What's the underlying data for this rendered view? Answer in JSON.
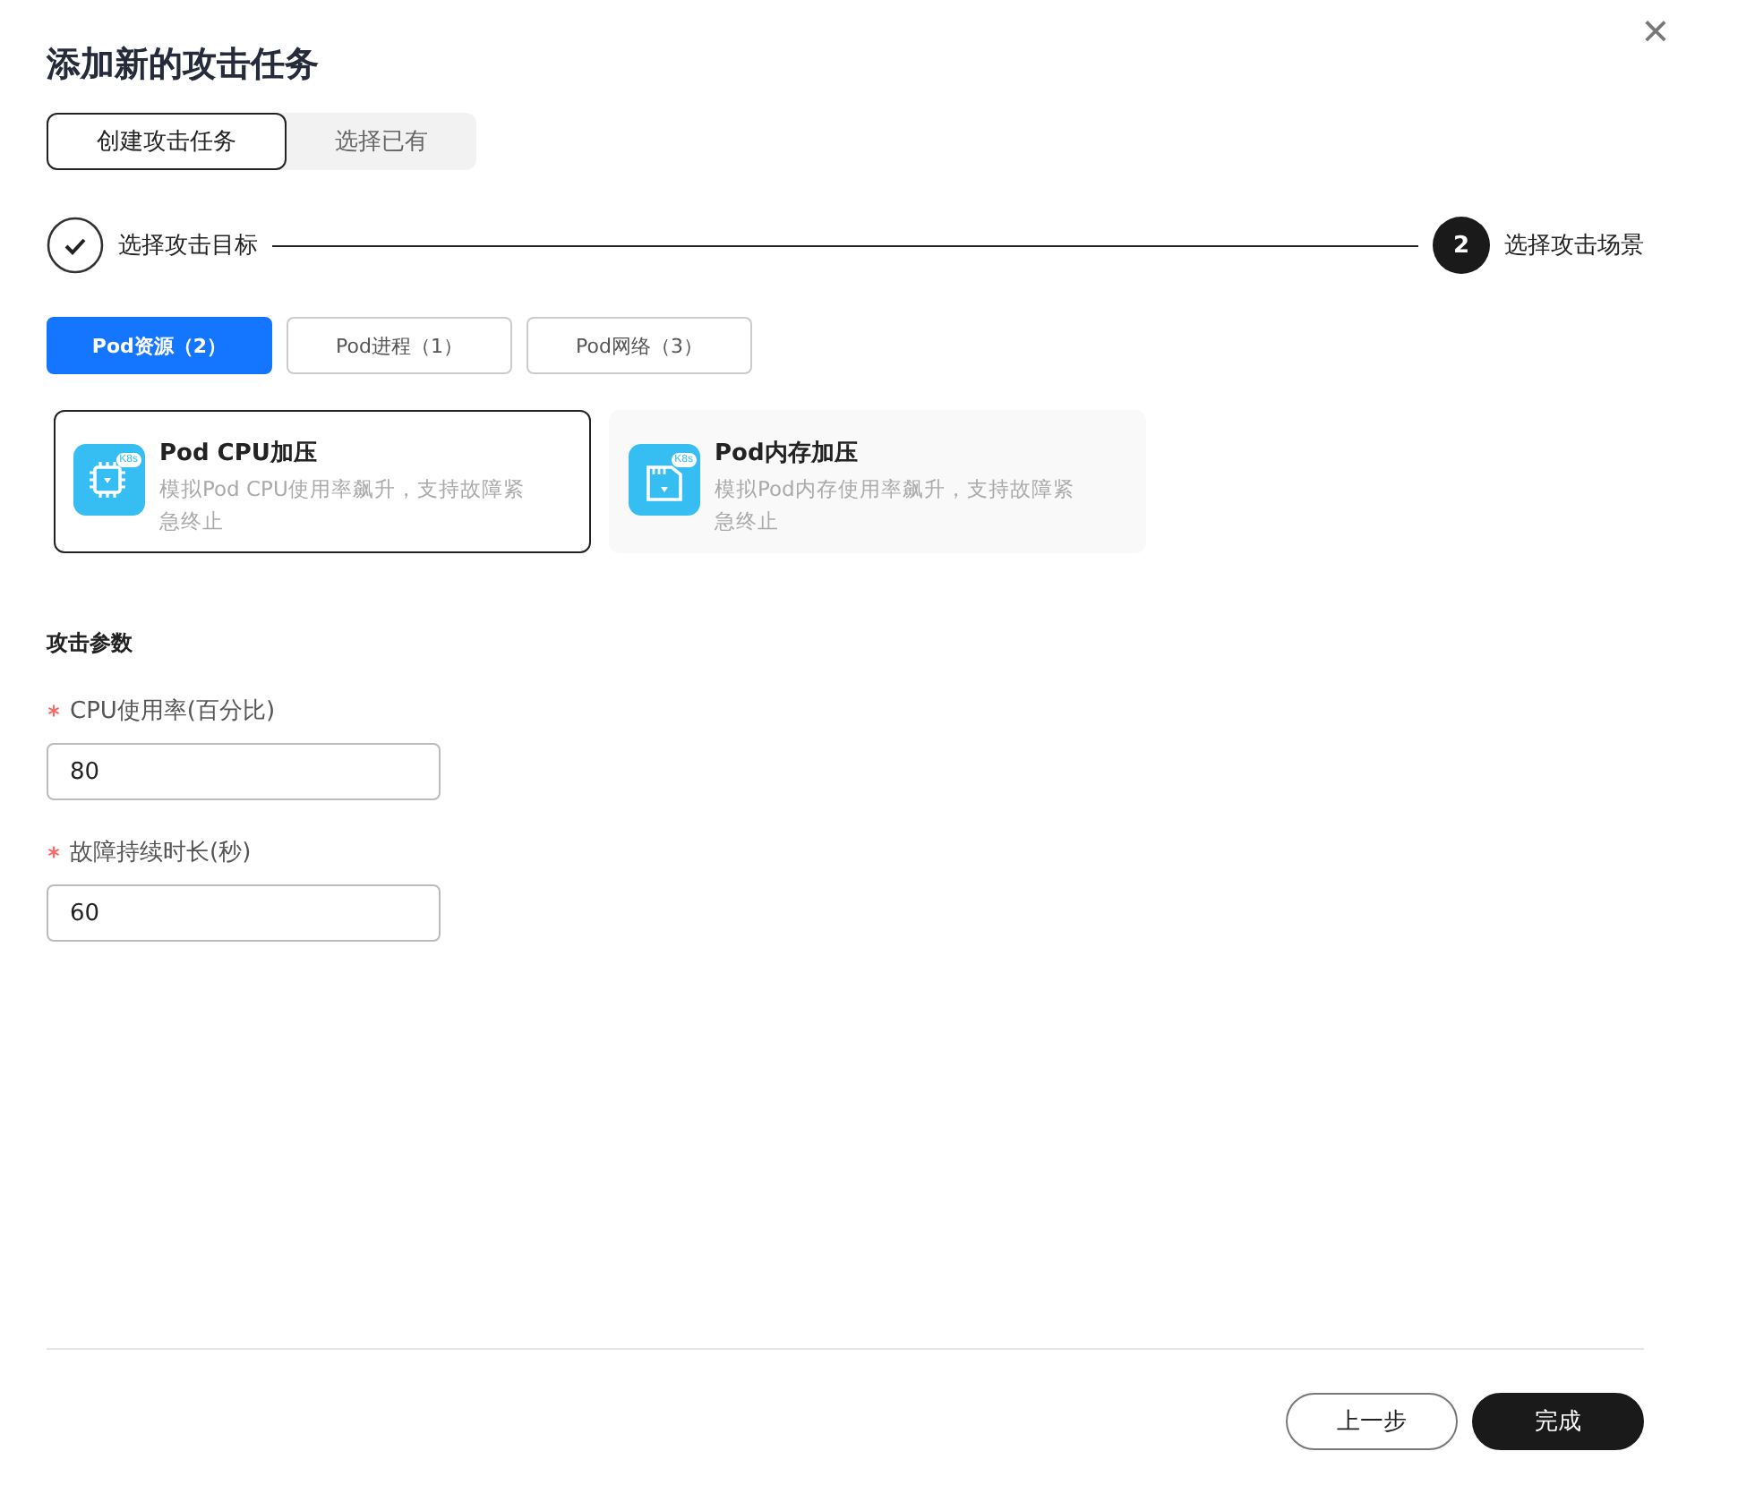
{
  "dialog": {
    "title": "添加新的攻击任务",
    "close": "×"
  },
  "mode_tabs": [
    {
      "label": "创建攻击任务",
      "selected": true
    },
    {
      "label": "选择已有",
      "selected": false
    }
  ],
  "steps": [
    {
      "label": "选择攻击目标",
      "done": true
    },
    {
      "label": "选择攻击场景",
      "number": "2",
      "done": false
    }
  ],
  "category_tabs": [
    {
      "label": "Pod资源（2）",
      "selected": true
    },
    {
      "label": "Pod进程（1）",
      "selected": false
    },
    {
      "label": "Pod网络（3）",
      "selected": false
    }
  ],
  "scenarios": [
    {
      "kind": "cpu",
      "title": "Pod CPU加压",
      "badge": "K8s",
      "description": "模拟Pod CPU使用率飙升，支持故障紧急终止",
      "selected": true
    },
    {
      "kind": "memory",
      "title": "Pod内存加压",
      "badge": "K8s",
      "description": "模拟Pod内存使用率飙升，支持故障紧急终止",
      "selected": false
    }
  ],
  "params": {
    "title": "攻击参数",
    "fields": [
      {
        "label": "CPU使用率(百分比)",
        "required": true,
        "value": "80"
      },
      {
        "label": "故障持续时长(秒)",
        "required": true,
        "value": "60"
      }
    ]
  },
  "footer": {
    "buttons": [
      {
        "kind": "secondary",
        "label": "上一步"
      },
      {
        "kind": "primary",
        "label": "完成"
      }
    ]
  }
}
